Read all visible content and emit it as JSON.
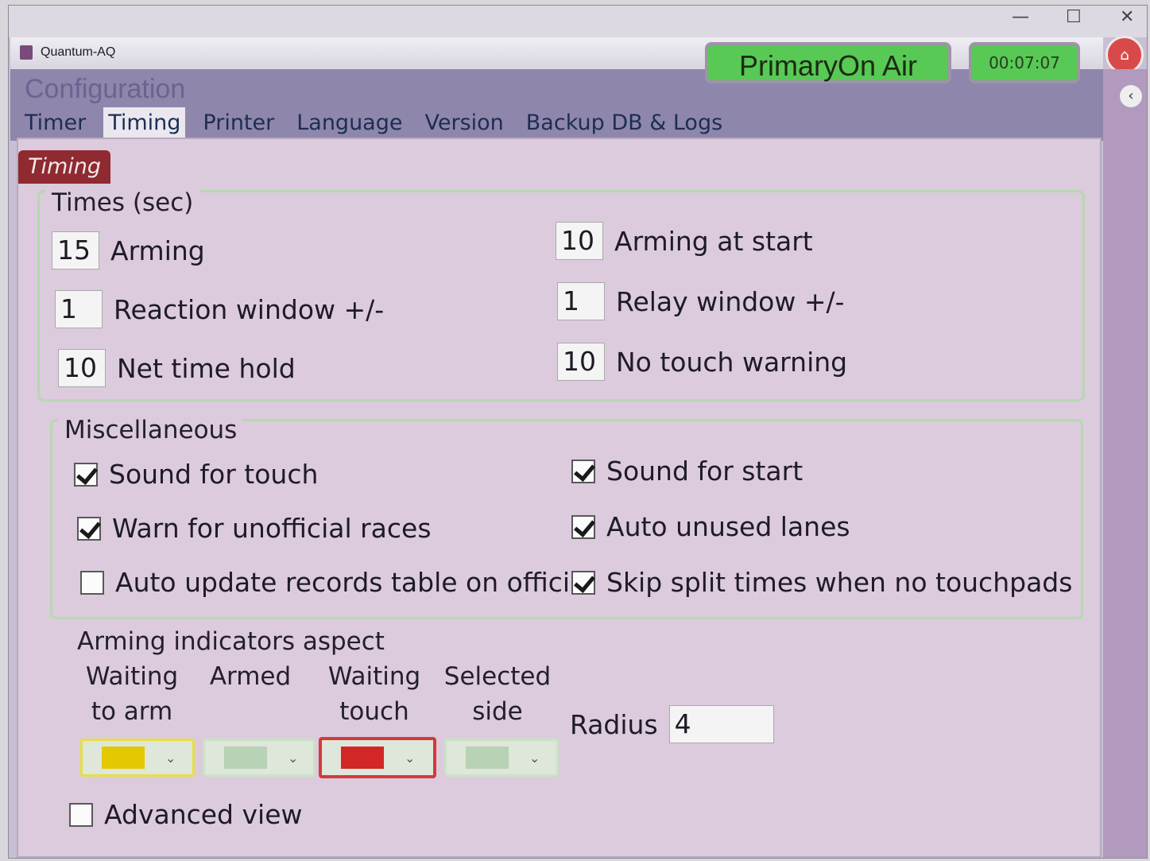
{
  "window": {
    "app_title": "Quantum-AQ",
    "controls": [
      "—",
      "☐",
      "✕"
    ]
  },
  "status": {
    "primary_label": "PrimaryOn Air",
    "clock": "00:07:07",
    "colors": {
      "active": "#57c954"
    }
  },
  "header": {
    "title": "Configuration",
    "tabs": [
      {
        "label": "Timer"
      },
      {
        "label": "Timing",
        "active": true
      },
      {
        "label": "Printer"
      },
      {
        "label": "Language"
      },
      {
        "label": "Version"
      },
      {
        "label": "Backup DB & Logs"
      }
    ]
  },
  "section": {
    "tag": "Timing"
  },
  "times": {
    "title": "Times (sec)",
    "fields": {
      "arming": {
        "value": "15",
        "label": "Arming"
      },
      "reaction_window": {
        "value": "1",
        "label": "Reaction window +/-"
      },
      "net_time_hold": {
        "value": "10",
        "label": "Net time hold"
      },
      "arming_at_start": {
        "value": "10",
        "label": "Arming at start"
      },
      "relay_window": {
        "value": "1",
        "label": "Relay window +/-"
      },
      "no_touch_warning": {
        "value": "10",
        "label": "No touch warning"
      }
    }
  },
  "misc": {
    "title": "Miscellaneous",
    "options": {
      "sound_for_touch": {
        "label": "Sound for touch",
        "checked": true
      },
      "warn_unofficial": {
        "label": "Warn for unofficial races",
        "checked": true
      },
      "auto_update_records": {
        "label": "Auto update records table on official",
        "checked": false
      },
      "sound_for_start": {
        "label": "Sound for start",
        "checked": true
      },
      "auto_unused_lanes": {
        "label": "Auto unused lanes",
        "checked": true
      },
      "skip_split_times": {
        "label": "Skip split times when no touchpads",
        "checked": true
      }
    }
  },
  "arming_indicators": {
    "title": "Arming indicators aspect",
    "columns": {
      "waiting_to_arm": {
        "line1": "Waiting",
        "line2": "to arm",
        "color": "#e3c800",
        "border": "#e6df42"
      },
      "armed": {
        "line1": "Armed",
        "line2": "",
        "color": "#b7d2b4",
        "border": "#cbe2c7"
      },
      "waiting_touch": {
        "line1": "Waiting",
        "line2": "touch",
        "color": "#d32626",
        "border": "#d33a3a"
      },
      "selected_side": {
        "line1": "Selected",
        "line2": "side",
        "color": "#b7d2b4",
        "border": "#cbe2c7"
      }
    },
    "radius_label": "Radius",
    "radius_value": "4"
  },
  "advanced": {
    "label": "Advanced view",
    "checked": false
  }
}
